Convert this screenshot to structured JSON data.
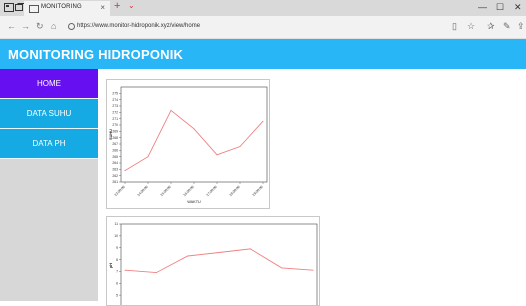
{
  "browser": {
    "tab_title": "MONITORING",
    "tab_close": "×",
    "new_tab": "+",
    "tab_menu": "⌄",
    "url": "https://www.monitor-hidroponik.xyz/view/home",
    "icons": [
      "back-icon",
      "forward-icon",
      "refresh-icon",
      "home-icon",
      "reading-view-icon",
      "favorite-icon",
      "favorites-list-icon",
      "notes-icon",
      "share-icon"
    ]
  },
  "header": {
    "title": "MONITORING HIDROPONIK"
  },
  "sidebar": {
    "items": [
      {
        "label": "HOME",
        "active": true
      },
      {
        "label": "DATA SUHU",
        "active": false
      },
      {
        "label": "DATA PH",
        "active": false
      }
    ]
  },
  "chart_data": [
    {
      "type": "line",
      "color": "#f08080",
      "ylabel": "SUHU",
      "xlabel": "WAKTU",
      "ylim": [
        261,
        276
      ],
      "yticks": [
        261,
        262,
        263,
        264,
        265,
        266,
        267,
        268,
        269,
        270,
        271,
        272,
        273,
        274,
        275
      ],
      "x": [
        "13:00:00",
        "14:00:00",
        "15:00:00",
        "16:00:00",
        "17:00:00",
        "18:00:00",
        "19:00:00"
      ],
      "values": [
        262.8,
        265.0,
        272.3,
        269.4,
        265.3,
        266.6,
        270.6
      ]
    },
    {
      "type": "line",
      "color": "#f08080",
      "ylabel": "pH",
      "xlabel": "",
      "ylim": [
        4,
        11
      ],
      "yticks": [
        5,
        6,
        7,
        8,
        9,
        10,
        11
      ],
      "x": [
        "",
        "",
        "",
        "",
        "",
        "",
        ""
      ],
      "values": [
        7.1,
        6.9,
        8.3,
        8.6,
        8.9,
        7.3,
        7.1
      ]
    }
  ]
}
